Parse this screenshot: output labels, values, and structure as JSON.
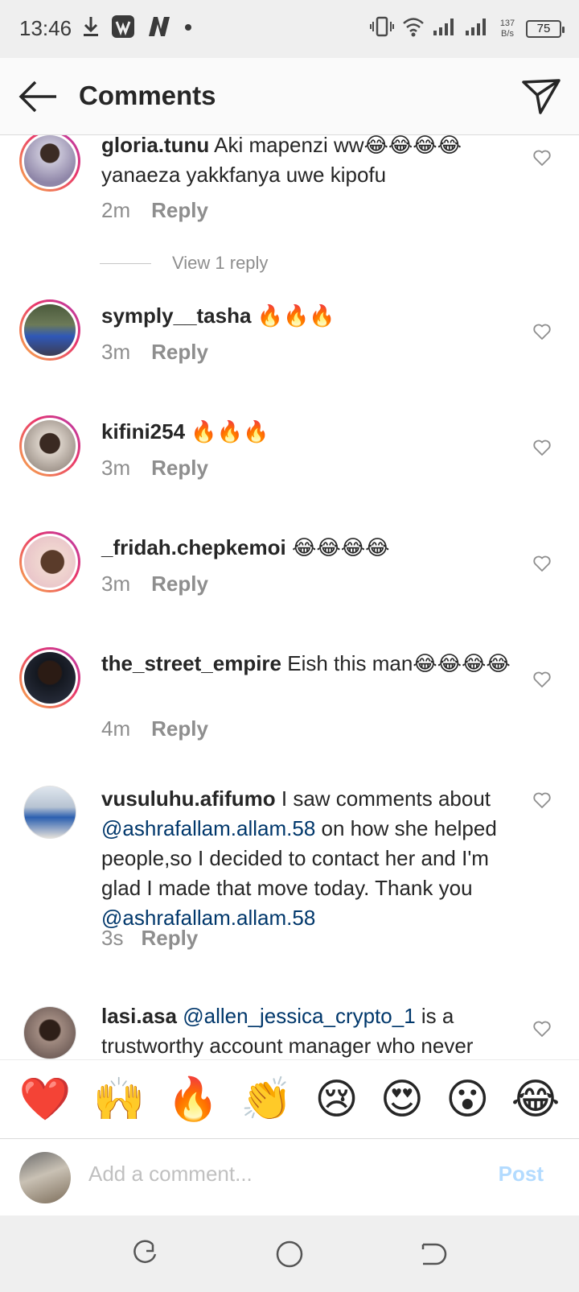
{
  "status_bar": {
    "time": "13:46",
    "left_icons": [
      "download-icon",
      "vidmate-icon",
      "n-app-icon",
      "dot-icon"
    ],
    "net_speed_value": "137",
    "net_speed_unit": "B/s",
    "battery": "75"
  },
  "header": {
    "title": "Comments",
    "back_icon": "arrow-left-icon",
    "send_icon": "paper-plane-icon"
  },
  "comments": [
    {
      "username": "gloria.tunu",
      "text": " Aki mapenzi ww😂😂😂😂 yanaeza yakkfanya uwe kipofu",
      "time": "2m",
      "reply": "Reply",
      "view_replies": "View 1 reply"
    },
    {
      "username": "symply__tasha",
      "text": " 🔥🔥🔥",
      "time": "3m",
      "reply": "Reply"
    },
    {
      "username": "kifini254",
      "text": " 🔥🔥🔥",
      "time": "3m",
      "reply": "Reply"
    },
    {
      "username": "_fridah.chepkemoi",
      "text": " 😂😂😂😂",
      "time": "3m",
      "reply": "Reply"
    },
    {
      "username": "the_street_empire",
      "text": " Eish this man😂😂😂😂",
      "time": "4m",
      "reply": "Reply"
    },
    {
      "username": "vusuluhu.afifumo",
      "text_1": " I saw comments about ",
      "mention_1": "@ashrafallam.allam.58",
      "text_2": " on how she helped people,so I decided to contact her and I'm glad I made that move today. Thank you ",
      "mention_2": "@ashrafallam.allam.58",
      "time": "3s",
      "reply": "Reply"
    },
    {
      "username": "lasi.asa",
      "mention_1": "@allen_jessica_crypto_1",
      "text_2": "  is a trustworthy account manager who never"
    }
  ],
  "emoji_bar": [
    "❤️",
    "🙌",
    "🔥",
    "👏",
    "😢",
    "😍",
    "😮",
    "😂"
  ],
  "composer": {
    "placeholder": "Add a comment...",
    "post_label": "Post"
  },
  "nav_bar": {
    "icons": [
      "recent-apps-icon",
      "home-icon",
      "back-nav-icon"
    ]
  },
  "colors": {
    "accent_link": "#00376b",
    "post_disabled": "#b3dbff",
    "meta_gray": "#8e8e8e"
  }
}
